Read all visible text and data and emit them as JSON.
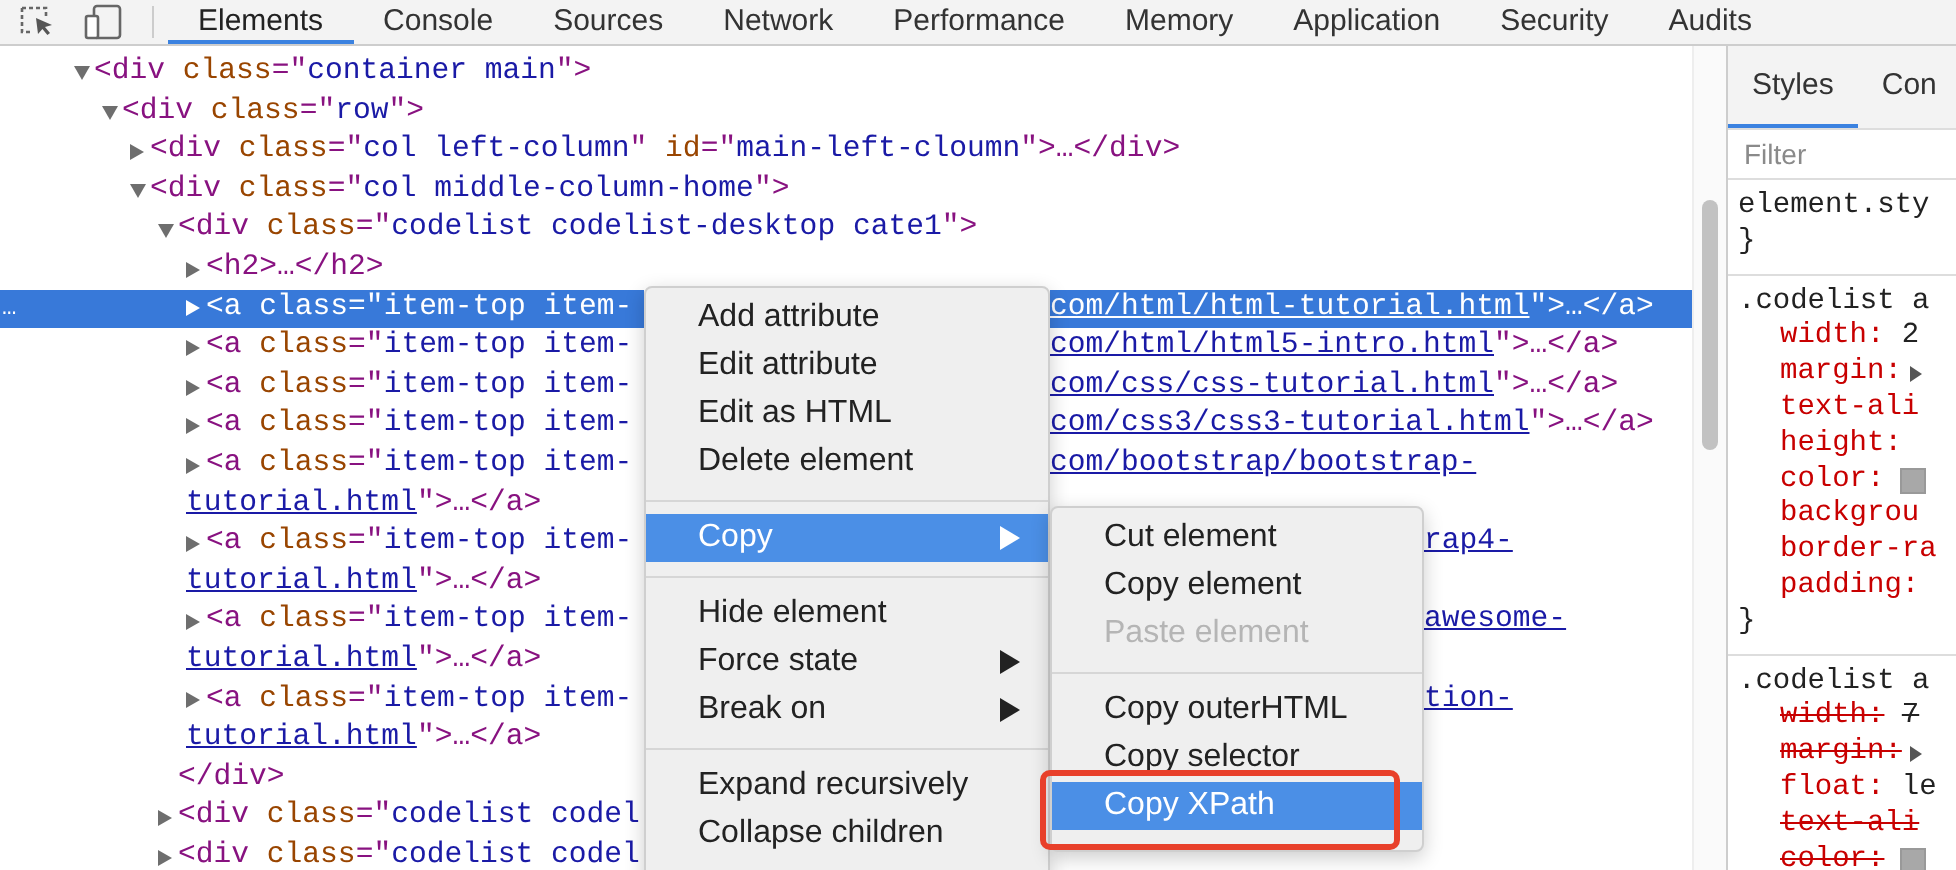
{
  "toolbar": {
    "tabs": [
      {
        "label": "Elements",
        "selected": true
      },
      {
        "label": "Console",
        "selected": false
      },
      {
        "label": "Sources",
        "selected": false
      },
      {
        "label": "Network",
        "selected": false
      },
      {
        "label": "Performance",
        "selected": false
      },
      {
        "label": "Memory",
        "selected": false
      },
      {
        "label": "Application",
        "selected": false
      },
      {
        "label": "Security",
        "selected": false
      },
      {
        "label": "Audits",
        "selected": false
      }
    ]
  },
  "dom": {
    "nodes": [
      {
        "expanded": true,
        "selected": false,
        "text": [
          {
            "kind": "tag",
            "text": "<div "
          },
          {
            "kind": "attr",
            "text": "class"
          },
          {
            "kind": "tag",
            "text": "=\""
          },
          {
            "kind": "value",
            "text": "container main"
          },
          {
            "kind": "tag",
            "text": "\">"
          }
        ],
        "children": [
          {
            "expanded": true,
            "selected": false,
            "text": [
              {
                "kind": "tag",
                "text": "<div "
              },
              {
                "kind": "attr",
                "text": "class"
              },
              {
                "kind": "tag",
                "text": "=\""
              },
              {
                "kind": "value",
                "text": "row"
              },
              {
                "kind": "tag",
                "text": "\">"
              }
            ],
            "children": [
              {
                "expanded": false,
                "selected": false,
                "text": [
                  {
                    "kind": "tag",
                    "text": "<div "
                  },
                  {
                    "kind": "attr",
                    "text": "class"
                  },
                  {
                    "kind": "tag",
                    "text": "=\""
                  },
                  {
                    "kind": "value",
                    "text": "col left-column"
                  },
                  {
                    "kind": "tag",
                    "text": "\" "
                  },
                  {
                    "kind": "attr",
                    "text": "id"
                  },
                  {
                    "kind": "tag",
                    "text": "=\""
                  },
                  {
                    "kind": "value",
                    "text": "main-left-cloumn"
                  },
                  {
                    "kind": "tag",
                    "text": "\">…</div>"
                  }
                ]
              },
              {
                "expanded": true,
                "selected": false,
                "text": [
                  {
                    "kind": "tag",
                    "text": "<div "
                  },
                  {
                    "kind": "attr",
                    "text": "class"
                  },
                  {
                    "kind": "tag",
                    "text": "=\""
                  },
                  {
                    "kind": "value",
                    "text": "col middle-column-home"
                  },
                  {
                    "kind": "tag",
                    "text": "\">"
                  }
                ],
                "children": [
                  {
                    "expanded": true,
                    "selected": false,
                    "text": [
                      {
                        "kind": "tag",
                        "text": "<div "
                      },
                      {
                        "kind": "attr",
                        "text": "class"
                      },
                      {
                        "kind": "tag",
                        "text": "=\""
                      },
                      {
                        "kind": "value",
                        "text": "codelist codelist-desktop cate1"
                      },
                      {
                        "kind": "tag",
                        "text": "\">"
                      }
                    ],
                    "close": [
                      {
                        "kind": "tag",
                        "text": "</div>"
                      }
                    ],
                    "children": [
                      {
                        "expanded": false,
                        "selected": false,
                        "text": [
                          {
                            "kind": "tag",
                            "text": "<h2>…</h2>"
                          }
                        ]
                      },
                      {
                        "expanded": false,
                        "selected": true,
                        "marker": "…",
                        "text": [
                          {
                            "kind": "tag",
                            "text": "<a "
                          },
                          {
                            "kind": "attr",
                            "text": "class"
                          },
                          {
                            "kind": "tag",
                            "text": "=\""
                          },
                          {
                            "kind": "value",
                            "text": "item-top item-"
                          }
                        ],
                        "after": {
                          "kind": "menu",
                          "parts": [
                            {
                              "kind": "link",
                              "text": "com/html/html-tutorial.html"
                            },
                            {
                              "kind": "tag",
                              "text": "\">…</a>"
                            }
                          ]
                        }
                      },
                      {
                        "expanded": false,
                        "selected": false,
                        "text": [
                          {
                            "kind": "tag",
                            "text": "<a "
                          },
                          {
                            "kind": "attr",
                            "text": "class"
                          },
                          {
                            "kind": "tag",
                            "text": "=\""
                          },
                          {
                            "kind": "value",
                            "text": "item-top item-"
                          }
                        ],
                        "after": {
                          "kind": "menu",
                          "parts": [
                            {
                              "kind": "link",
                              "text": "com/html/html5-intro.html"
                            },
                            {
                              "kind": "tag",
                              "text": "\">…</a>"
                            }
                          ]
                        }
                      },
                      {
                        "expanded": false,
                        "selected": false,
                        "text": [
                          {
                            "kind": "tag",
                            "text": "<a "
                          },
                          {
                            "kind": "attr",
                            "text": "class"
                          },
                          {
                            "kind": "tag",
                            "text": "=\""
                          },
                          {
                            "kind": "value",
                            "text": "item-top item-"
                          }
                        ],
                        "after": {
                          "kind": "menu",
                          "parts": [
                            {
                              "kind": "link",
                              "text": "com/css/css-tutorial.html"
                            },
                            {
                              "kind": "tag",
                              "text": "\">…</a>"
                            }
                          ]
                        }
                      },
                      {
                        "expanded": false,
                        "selected": false,
                        "text": [
                          {
                            "kind": "tag",
                            "text": "<a "
                          },
                          {
                            "kind": "attr",
                            "text": "class"
                          },
                          {
                            "kind": "tag",
                            "text": "=\""
                          },
                          {
                            "kind": "value",
                            "text": "item-top item-"
                          }
                        ],
                        "after": {
                          "kind": "menu",
                          "parts": [
                            {
                              "kind": "link",
                              "text": "com/css3/css3-tutorial.html"
                            },
                            {
                              "kind": "tag",
                              "text": "\">…</a>"
                            }
                          ]
                        }
                      },
                      {
                        "expanded": false,
                        "selected": false,
                        "text": [
                          {
                            "kind": "tag",
                            "text": "<a "
                          },
                          {
                            "kind": "attr",
                            "text": "class"
                          },
                          {
                            "kind": "tag",
                            "text": "=\""
                          },
                          {
                            "kind": "value",
                            "text": "item-top item-"
                          }
                        ],
                        "after": {
                          "kind": "menu",
                          "parts": [
                            {
                              "kind": "link",
                              "text": "com/bootstrap/bootstrap-"
                            }
                          ]
                        },
                        "wrap": [
                          {
                            "kind": "link",
                            "text": "tutorial.html"
                          },
                          {
                            "kind": "tag",
                            "text": "\">…</a>"
                          }
                        ]
                      },
                      {
                        "expanded": false,
                        "selected": false,
                        "text": [
                          {
                            "kind": "tag",
                            "text": "<a "
                          },
                          {
                            "kind": "attr",
                            "text": "class"
                          },
                          {
                            "kind": "tag",
                            "text": "=\""
                          },
                          {
                            "kind": "value",
                            "text": "item-top item-"
                          }
                        ],
                        "after": {
                          "kind": "submenu",
                          "parts": [
                            {
                              "kind": "link",
                              "text": "rap4-"
                            }
                          ]
                        },
                        "wrap": [
                          {
                            "kind": "link",
                            "text": "tutorial.html"
                          },
                          {
                            "kind": "tag",
                            "text": "\">…</a>"
                          }
                        ]
                      },
                      {
                        "expanded": false,
                        "selected": false,
                        "text": [
                          {
                            "kind": "tag",
                            "text": "<a "
                          },
                          {
                            "kind": "attr",
                            "text": "class"
                          },
                          {
                            "kind": "tag",
                            "text": "=\""
                          },
                          {
                            "kind": "value",
                            "text": "item-top item-"
                          }
                        ],
                        "after": {
                          "kind": "submenu",
                          "parts": [
                            {
                              "kind": "link",
                              "text": "awesome-"
                            }
                          ]
                        },
                        "wrap": [
                          {
                            "kind": "link",
                            "text": "tutorial.html"
                          },
                          {
                            "kind": "tag",
                            "text": "\">…</a>"
                          }
                        ]
                      },
                      {
                        "expanded": false,
                        "selected": false,
                        "text": [
                          {
                            "kind": "tag",
                            "text": "<a "
                          },
                          {
                            "kind": "attr",
                            "text": "class"
                          },
                          {
                            "kind": "tag",
                            "text": "=\""
                          },
                          {
                            "kind": "value",
                            "text": "item-top item-"
                          }
                        ],
                        "after": {
                          "kind": "submenu",
                          "parts": [
                            {
                              "kind": "link",
                              "text": "tion-"
                            }
                          ]
                        },
                        "wrap": [
                          {
                            "kind": "link",
                            "text": "tutorial.html"
                          },
                          {
                            "kind": "tag",
                            "text": "\">…</a>"
                          }
                        ]
                      }
                    ]
                  },
                  {
                    "expanded": false,
                    "selected": false,
                    "text": [
                      {
                        "kind": "tag",
                        "text": "<div "
                      },
                      {
                        "kind": "attr",
                        "text": "class"
                      },
                      {
                        "kind": "tag",
                        "text": "=\""
                      },
                      {
                        "kind": "value",
                        "text": "codelist codel"
                      }
                    ]
                  },
                  {
                    "expanded": false,
                    "selected": false,
                    "text": [
                      {
                        "kind": "tag",
                        "text": "<div "
                      },
                      {
                        "kind": "attr",
                        "text": "class"
                      },
                      {
                        "kind": "tag",
                        "text": "=\""
                      },
                      {
                        "kind": "value",
                        "text": "codelist codel"
                      }
                    ]
                  }
                ]
              }
            ]
          }
        ]
      }
    ]
  },
  "styles_panel": {
    "tabs": [
      {
        "label": "Styles",
        "selected": true
      },
      {
        "label": "Con",
        "selected": false
      }
    ],
    "filter": {
      "placeholder": "Filter"
    },
    "rules": [
      {
        "selector": "element.sty",
        "close": "}"
      },
      {
        "selector": ".codelist a",
        "close": "}",
        "properties": [
          {
            "name": "width:",
            "value": "2",
            "overridden": false
          },
          {
            "name": "margin:",
            "expandable": true,
            "overridden": false
          },
          {
            "name": "text-ali",
            "overridden": false
          },
          {
            "name": "height:",
            "overridden": false
          },
          {
            "name": "color:",
            "color": "#a8a8a8",
            "overridden": false
          },
          {
            "name": "backgrou",
            "overridden": false
          },
          {
            "name": "border-ra",
            "overridden": false
          },
          {
            "name": "padding:",
            "overridden": false
          }
        ]
      },
      {
        "selector": ".codelist a",
        "properties": [
          {
            "name": "width:",
            "value": "7",
            "overridden": true
          },
          {
            "name": "margin:",
            "expandable": true,
            "overridden": true
          },
          {
            "name": "float:",
            "value": "le",
            "overridden": false
          },
          {
            "name": "text-ali",
            "overridden": true
          },
          {
            "name": "color:",
            "color": "#a8a8a8",
            "overridden": true
          }
        ]
      }
    ]
  },
  "context_menu": {
    "items": [
      {
        "kind": "item",
        "label": "Add attribute",
        "highlighted": false,
        "has_submenu": false
      },
      {
        "kind": "item",
        "label": "Edit attribute",
        "highlighted": false,
        "has_submenu": false
      },
      {
        "kind": "item",
        "label": "Edit as HTML",
        "highlighted": false,
        "has_submenu": false
      },
      {
        "kind": "item",
        "label": "Delete element",
        "highlighted": false,
        "has_submenu": false
      },
      {
        "kind": "separator"
      },
      {
        "kind": "item",
        "label": "Copy",
        "highlighted": true,
        "has_submenu": true
      },
      {
        "kind": "separator"
      },
      {
        "kind": "item",
        "label": "Hide element",
        "highlighted": false,
        "has_submenu": false
      },
      {
        "kind": "item",
        "label": "Force state",
        "highlighted": false,
        "has_submenu": true
      },
      {
        "kind": "item",
        "label": "Break on",
        "highlighted": false,
        "has_submenu": true
      },
      {
        "kind": "separator"
      },
      {
        "kind": "item",
        "label": "Expand recursively",
        "highlighted": false,
        "has_submenu": false
      },
      {
        "kind": "item",
        "label": "Collapse children",
        "highlighted": false,
        "has_submenu": false
      }
    ]
  },
  "submenu": {
    "items": [
      {
        "kind": "item",
        "label": "Cut element",
        "highlighted": false,
        "disabled": false
      },
      {
        "kind": "item",
        "label": "Copy element",
        "highlighted": false,
        "disabled": false
      },
      {
        "kind": "item",
        "label": "Paste element",
        "highlighted": false,
        "disabled": true
      },
      {
        "kind": "separator"
      },
      {
        "kind": "item",
        "label": "Copy outerHTML",
        "highlighted": false,
        "disabled": false
      },
      {
        "kind": "item",
        "label": "Copy selector",
        "highlighted": false,
        "disabled": false
      },
      {
        "kind": "item",
        "label": "Copy XPath",
        "highlighted": true,
        "disabled": false,
        "annotated": true
      }
    ]
  }
}
